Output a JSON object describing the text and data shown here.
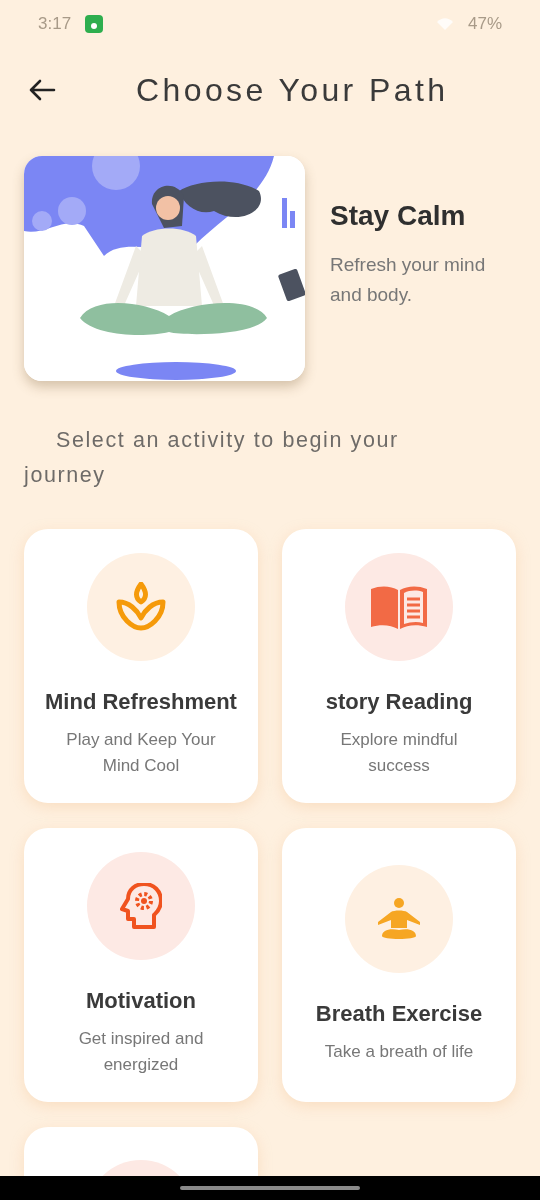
{
  "status_bar": {
    "time": "3:17",
    "battery": "47%"
  },
  "header": {
    "title": "Choose Your Path"
  },
  "hero": {
    "title": "Stay Calm",
    "subtitle": "Refresh your mind and body."
  },
  "prompt": "Select an activity to begin your journey",
  "cards": [
    {
      "kind": "lotus",
      "color": "#fef0e2",
      "title": "Mind Refreshment",
      "description": "Play and Keep Your Mind Cool"
    },
    {
      "kind": "book",
      "color": "#fde9e4",
      "title": "story Reading",
      "description": "Explore mindful success"
    },
    {
      "kind": "head",
      "color": "#fde9e4",
      "title": "Motivation",
      "description": "Get inspired and energized"
    },
    {
      "kind": "yoga",
      "color": "#fef0e2",
      "title": "Breath Exercise",
      "description": "Take a breath of life"
    },
    {
      "kind": "partial",
      "color": "#fde9e4"
    }
  ]
}
